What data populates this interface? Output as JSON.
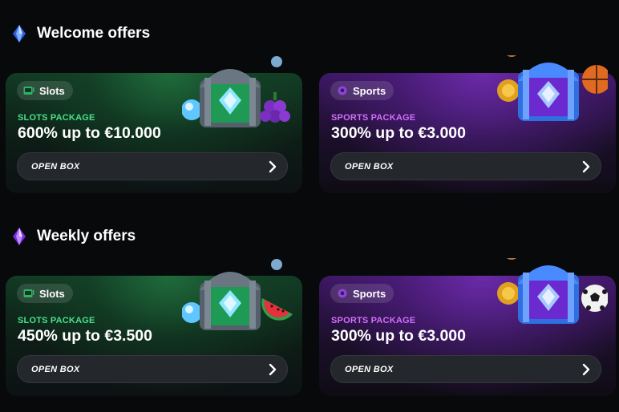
{
  "sections": [
    {
      "title": "Welcome offers",
      "gem_color": "#3a7bff",
      "cards": [
        {
          "category": "Slots",
          "package": "SLOTS PACKAGE",
          "amount": "600% up to €10.000",
          "button": "OPEN BOX",
          "theme": "slots",
          "extra": "grapes"
        },
        {
          "category": "Sports",
          "package": "SPORTS PACKAGE",
          "amount": "300% up to €3.000",
          "button": "OPEN BOX",
          "theme": "sports",
          "extra": "basketball"
        }
      ]
    },
    {
      "title": "Weekly offers",
      "gem_color": "#a24cff",
      "cards": [
        {
          "category": "Slots",
          "package": "SLOTS PACKAGE",
          "amount": "450% up to €3.500",
          "button": "OPEN BOX",
          "theme": "slots",
          "extra": "watermelon"
        },
        {
          "category": "Sports",
          "package": "SPORTS PACKAGE",
          "amount": "300% up to €3.000",
          "button": "OPEN BOX",
          "theme": "sports",
          "extra": "soccer-ball"
        }
      ]
    }
  ],
  "colors": {
    "slots_accent": "#47e08a",
    "sports_accent": "#d46cff",
    "button_bg": "#24272c",
    "page_bg": "#07090b"
  }
}
